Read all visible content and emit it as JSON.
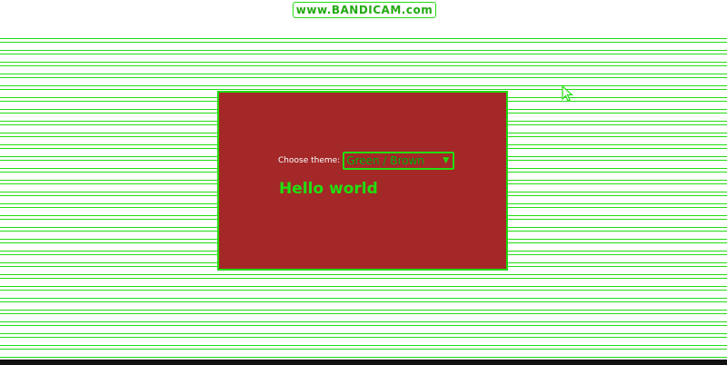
{
  "watermark": {
    "text": "www.BANDICAM.com"
  },
  "theme_picker": {
    "label": "Choose theme:",
    "selected": "Green / Brown"
  },
  "content": {
    "heading": "Hello world"
  },
  "colors": {
    "panel_background": "#a42828",
    "accent_green": "#22dd11",
    "page_background": "#ffffff"
  },
  "icons": {
    "dropdown": "chevron-down-icon",
    "pointer": "mouse-cursor-icon"
  }
}
